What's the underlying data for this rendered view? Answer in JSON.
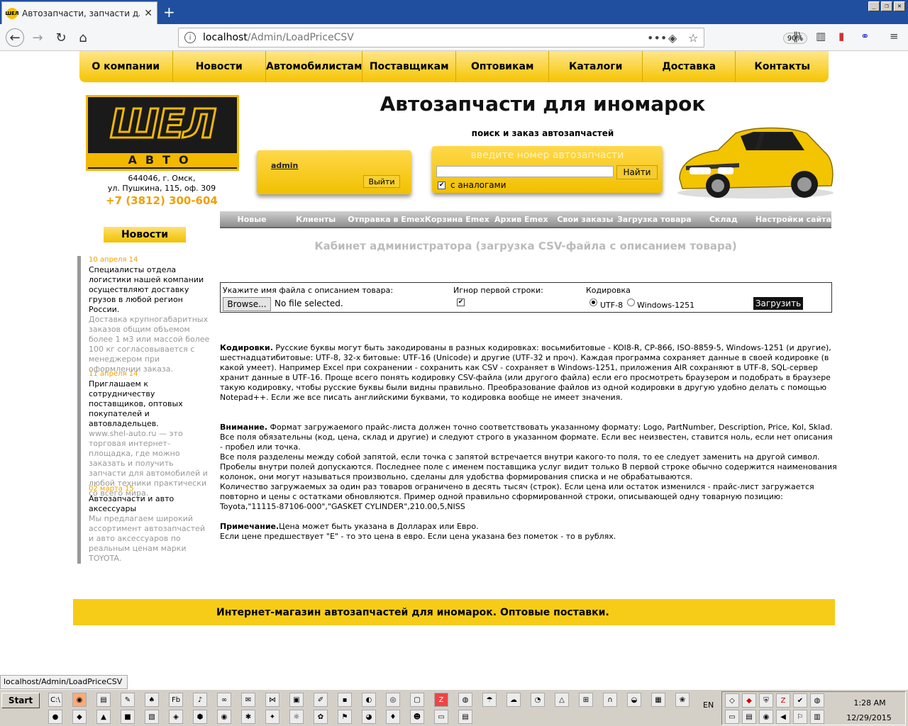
{
  "browser": {
    "tab_title": "Автозапчасти, запчасти для ино",
    "url_host": "localhost",
    "url_path": "/Admin/LoadPriceCSV",
    "zoom": "90%",
    "status_url": "localhost/Admin/LoadPriceCSV"
  },
  "top_menu": [
    "О компании",
    "Новости",
    "Автомобилистам",
    "Поставщикам",
    "Оптовикам",
    "Каталоги",
    "Доставка",
    "Контакты"
  ],
  "logo": {
    "big": "ШЕЛ",
    "small": "АВТО"
  },
  "address": {
    "line1": "644046, г. Омск,",
    "line2": "ул. Пушкина, 115, оф. 309",
    "phone": "+7 (3812) 300-604"
  },
  "header": {
    "title": "Автозапчасти для иномарок",
    "subtitle": "поиск и заказ автозапчастей"
  },
  "login": {
    "user": "admin",
    "logout": "Выйти"
  },
  "search": {
    "label": "введите номер автозапчасти",
    "button": "Найти",
    "analogs": "с аналогами",
    "analogs_checked": true
  },
  "admin_menu": [
    "Новые",
    "Клиенты",
    "Отправка в Emex",
    "Корзина Emex",
    "Архив Emex",
    "Свои заказы",
    "Загрузка товара",
    "Склад",
    "Настройки сайта"
  ],
  "cabinet_title": "Кабинет администратора (загрузка CSV-файла с описанием товара)",
  "news": {
    "button": "Новости",
    "items": [
      {
        "date": "10 апреля 14",
        "headline": "Специалисты отдела логистики нашей компании осуществляют доставку грузов в любой регион России.",
        "body": "Доставка крупногабаритных заказов общим объемом более 1 м3 или массой более 100 кг согласовывается с менеджером при оформлении заказа."
      },
      {
        "date": "11 апреля 14",
        "headline": "Приглашаем к сотрудничеству поставщиков, оптовых покупателей и автовладельцев.",
        "body": "www.shel-auto.ru — это торговая интернет-площадка, где можно заказать и получить запчасти для автомобилей и любой техники практически со всего мира."
      },
      {
        "date": "02 марта 15",
        "headline": "Автозапчасти и авто аксессуары",
        "body": "Мы предлагаем широкий ассортимент автозапчастей и авто аксессуаров по реальным ценам марки TOYOTA."
      }
    ]
  },
  "upload_form": {
    "file_label": "Укажите имя файла с описанием товара:",
    "browse": "Browse...",
    "no_file": "No file selected.",
    "ignore_label": "Игнор первой строки:",
    "ignore_checked": true,
    "encoding_label": "Кодировка",
    "enc1": "UTF-8",
    "enc2": "Windows-1251",
    "enc_selected": "UTF-8",
    "submit": "Загрузить"
  },
  "info": {
    "enc_head": "Кодировки.",
    "enc_text": " Русские буквы могут быть закодированы в разных кодировках: восьмибитовые - KOI8-R, CP-866, ISO-8859-5, Windows-1251 (и другие), шестнадцатибитовые: UTF-8, 32-х битовые: UTF-16 (Unicode) и другие (UTF-32 и проч). Каждая программа сохраняет данные в своей кодировке (в какой умеет). Например Excel при сохранении - сохранить как CSV - сохраняет в Windows-1251, приложения AIR сохраняют в UTF-8, SQL-сервер хранит данные в UTF-16. Проще всего понять кодировку CSV-файла (или другого файла) если его просмотреть браузером и подобрать в браузере такую кодировку, чтобы русские буквы были видны правильно. Преобразование файлов из одной кодировки в другую удобно делать с помощью Notepad++. Если же все писать английскими буквами, то кодировка вообще не имеет значения.",
    "att_head": "Внимание.",
    "att_text": " Формат загружаемого прайс-листа должен точно соответствовать указанному формату: Logo, PartNumber, Description, Price, Kol, Sklad.",
    "att_line2": "Все поля обязательны (код, цена, склад и другие) и следуют строго в указанном формате. Если вес неизвестен, ставится ноль, если нет описания - пробел или точка.",
    "att_line3": "Все поля разделены между собой запятой, если точка с запятой встречается внутри какого-то поля, то ее следует заменить на другой символ. Пробелы внутри полей допускаются. Последнее поле с именем поставщика услуг видит только В первой строке обычно содержится наименования колонок, они могут называться произвольно, сделаны для удобства формирования списка и не обрабатываются.",
    "att_line4": "Количество загружаемых за один раз товаров ограничено в десять тысяч (строк). Если цена или остаток изменился - прайс-лист загружается повторно и цены с остатками обновляются. Пример одной правильно сформированной строки, описывающей одну товарную позицию:",
    "att_example": "Toyota,\"11115-87106-000\",\"GASKET CYLINDER\",210.00,5,NISS",
    "note_head": "Примечание.",
    "note_text": "Цена может быть указана в Долларах или Евро.",
    "note_line2": "Если цене предшествует \"E\" - то это цена в евро. Если цена указана без пометок - то в рублях."
  },
  "footer": "Интернет-магазин автозапчастей для иномарок. Оптовые поставки.",
  "taskbar": {
    "start": "Start",
    "lang": "EN",
    "time": "1:28 AM",
    "date": "12/29/2015"
  }
}
